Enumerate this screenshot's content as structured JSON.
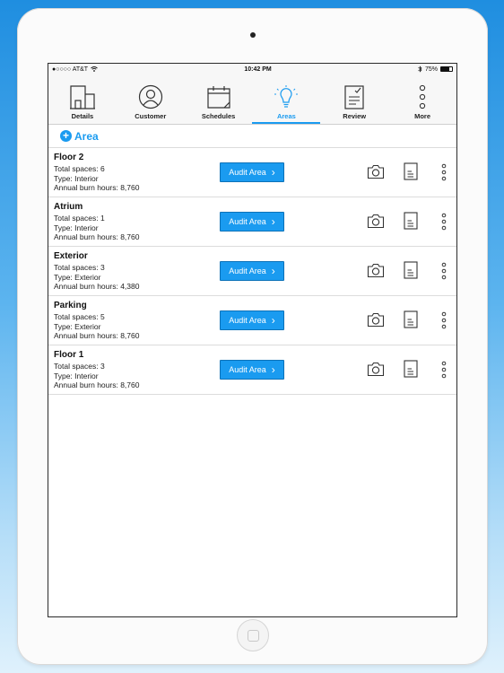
{
  "statusbar": {
    "carrier": "●○○○○ AT&T",
    "time": "10:42 PM",
    "battery": "75%"
  },
  "tabs": [
    {
      "label": "Details",
      "icon": "buildings-icon",
      "active": false
    },
    {
      "label": "Customer",
      "icon": "user-circle-icon",
      "active": false
    },
    {
      "label": "Schedules",
      "icon": "calendar-icon",
      "active": false
    },
    {
      "label": "Areas",
      "icon": "lightbulb-icon",
      "active": true
    },
    {
      "label": "Review",
      "icon": "clipboard-check-icon",
      "active": false
    },
    {
      "label": "More",
      "icon": "more-dots-icon",
      "active": false
    }
  ],
  "add_area": {
    "label": "Area"
  },
  "audit_label": "Audit Area",
  "areas": [
    {
      "name": "Floor 2",
      "spaces": "Total spaces: 6",
      "type": "Type: Interior",
      "hours": "Annual burn hours: 8,760"
    },
    {
      "name": "Atrium",
      "spaces": "Total spaces: 1",
      "type": "Type: Interior",
      "hours": "Annual burn hours: 8,760"
    },
    {
      "name": "Exterior",
      "spaces": "Total spaces: 3",
      "type": "Type: Exterior",
      "hours": "Annual burn hours: 4,380"
    },
    {
      "name": "Parking",
      "spaces": "Total spaces: 5",
      "type": "Type: Exterior",
      "hours": "Annual burn hours: 8,760"
    },
    {
      "name": "Floor 1",
      "spaces": "Total spaces: 3",
      "type": "Type: Interior",
      "hours": "Annual burn hours: 8,760"
    }
  ],
  "colors": {
    "accent": "#1a9bf0",
    "border": "#dcdcdc"
  }
}
